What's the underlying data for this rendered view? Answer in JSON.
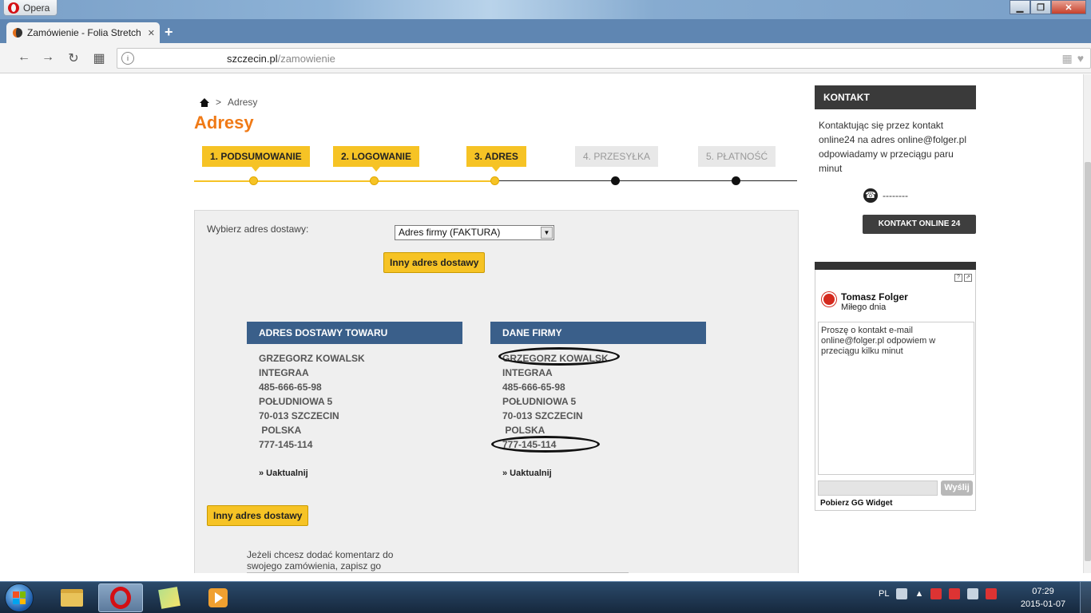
{
  "browser": {
    "menu_label": "Opera",
    "tab_title": "Zamówienie - Folia Stretch",
    "tab_close": "✕",
    "new_tab": "+",
    "url_host": "szczecin.pl",
    "url_path": "/zamowienie",
    "window_controls": [
      "▁",
      "❐",
      "✕"
    ]
  },
  "breadcrumb": {
    "separator": ">",
    "current": "Adresy"
  },
  "page_title": "Adresy",
  "steps": [
    {
      "label": "1. PODSUMOWANIE",
      "state": "done"
    },
    {
      "label": "2. LOGOWANIE",
      "state": "done"
    },
    {
      "label": "3. ADRES",
      "state": "done"
    },
    {
      "label": "4. PRZESYŁKA",
      "state": "todo"
    },
    {
      "label": "5. PŁATNOŚĆ",
      "state": "todo"
    }
  ],
  "delivery": {
    "select_label": "Wybierz adres dostawy:",
    "select_value": "Adres firmy (FAKTURA)",
    "other_address_button": "Inny adres dostawy",
    "other_address_button_2": "Inny adres dostawy"
  },
  "address_shipping": {
    "heading": "ADRES DOSTAWY TOWARU",
    "lines": [
      "GRZEGORZ KOWALSK",
      "INTEGRAA",
      "485-666-65-98",
      "POŁUDNIOWA 5",
      "70-013 SZCZECIN",
      " POLSKA",
      "777-145-114"
    ],
    "update_link": "» Uaktualnij"
  },
  "address_company": {
    "heading": "DANE FIRMY",
    "lines": [
      "GRZEGORZ KOWALSK",
      "INTEGRAA",
      "485-666-65-98",
      "POŁUDNIOWA 5",
      "70-013 SZCZECIN",
      " POLSKA",
      "777-145-114"
    ],
    "update_link": "» Uaktualnij"
  },
  "comment": {
    "text": "Jeżeli chcesz dodać komentarz do swojego zamówienia, zapisz go poniżej."
  },
  "sidebar": {
    "kontakt_heading": "KONTAKT",
    "kontakt_text": "Kontaktując się przez kontakt online24 na adres online@folger.pl odpowiadamy w przeciągu paru minut",
    "phone": "--------",
    "kontakt_button": "KONTAKT ONLINE 24"
  },
  "gg_widget": {
    "help": "?",
    "popout": "⇗",
    "name": "Tomasz Folger",
    "status": "Miłego dnia",
    "message": "Proszę o kontakt e-mail online@folger.pl odpowiem w przeciągu kilku minut",
    "send_button": "Wyślij",
    "footer": "Pobierz GG Widget"
  },
  "taskbar": {
    "language": "PL",
    "time": "07:29",
    "date": "2015-01-07"
  },
  "colors": {
    "accent_orange": "#f07a16",
    "step_yellow": "#f6c325",
    "header_blue": "#3a5f8a",
    "sidebar_dark": "#3a3a3a"
  }
}
